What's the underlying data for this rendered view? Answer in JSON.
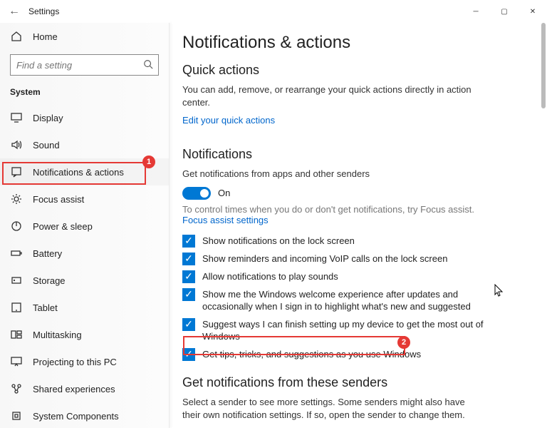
{
  "window": {
    "title": "Settings"
  },
  "sidebar": {
    "home": "Home",
    "search_placeholder": "Find a setting",
    "section": "System",
    "items": [
      {
        "label": "Display"
      },
      {
        "label": "Sound"
      },
      {
        "label": "Notifications & actions",
        "selected": true
      },
      {
        "label": "Focus assist"
      },
      {
        "label": "Power & sleep"
      },
      {
        "label": "Battery"
      },
      {
        "label": "Storage"
      },
      {
        "label": "Tablet"
      },
      {
        "label": "Multitasking"
      },
      {
        "label": "Projecting to this PC"
      },
      {
        "label": "Shared experiences"
      },
      {
        "label": "System Components"
      }
    ]
  },
  "main": {
    "title": "Notifications & actions",
    "quick_actions": {
      "heading": "Quick actions",
      "desc": "You can add, remove, or rearrange your quick actions directly in action center.",
      "link": "Edit your quick actions"
    },
    "notifications": {
      "heading": "Notifications",
      "desc": "Get notifications from apps and other senders",
      "toggle_label": "On",
      "hint": "To control times when you do or don't get notifications, try Focus assist.",
      "hint_link": "Focus assist settings",
      "checkboxes": [
        "Show notifications on the lock screen",
        "Show reminders and incoming VoIP calls on the lock screen",
        "Allow notifications to play sounds",
        "Show me the Windows welcome experience after updates and occasionally when I sign in to highlight what's new and suggested",
        "Suggest ways I can finish setting up my device to get the most out of Windows",
        "Get tips, tricks, and suggestions as you use Windows"
      ]
    },
    "senders": {
      "heading": "Get notifications from these senders",
      "desc": "Select a sender to see more settings. Some senders might also have their own notification settings. If so, open the sender to change them."
    }
  },
  "annotations": {
    "b1": "1",
    "b2": "2"
  }
}
